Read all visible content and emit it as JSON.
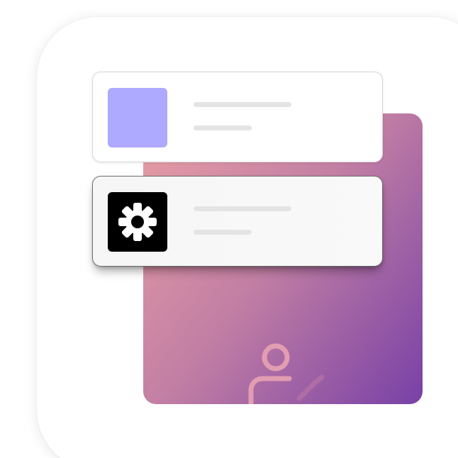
{
  "illustration": {
    "icon_names": [
      "gear-icon",
      "person-pointer-icon"
    ],
    "colors": {
      "accent_lavender": "#aeaaff",
      "gradient_start": "#e39aa4",
      "gradient_end": "#7b43a6",
      "gear_tile": "#000000",
      "placeholder_line": "#e4e4e4"
    }
  }
}
